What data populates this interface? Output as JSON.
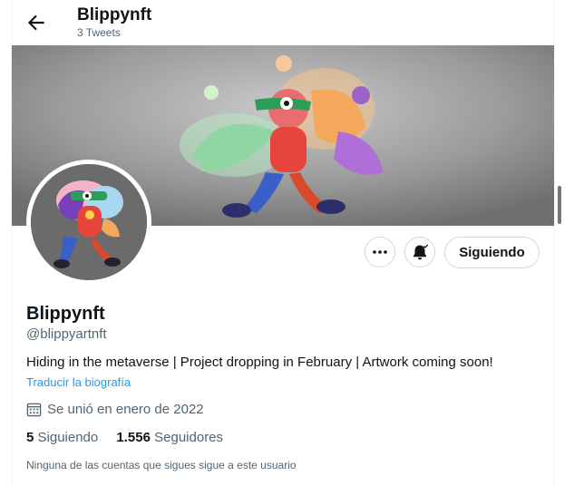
{
  "header": {
    "name": "Blippynft",
    "tweet_count": "3 Tweets"
  },
  "profile": {
    "display_name": "Blippynft",
    "handle": "@blippyartnft",
    "bio": "Hiding in the metaverse | Project dropping in February | Artwork coming soon!",
    "translate_link": "Traducir la biografía",
    "joined": "Se unió en enero de 2022",
    "following_count": "5",
    "following_label": "Siguiendo",
    "followers_count": "1.556",
    "followers_label": "Seguidores",
    "no_common_followers": "Ninguna de las cuentas que sigues sigue a este usuario"
  },
  "actions": {
    "follow_button": "Siguiendo"
  },
  "icons": {
    "back": "arrow-left-icon",
    "more": "more-dots-icon",
    "notifications": "bell-check-icon",
    "calendar": "calendar-icon"
  },
  "colors": {
    "accent": "#1d9bf0",
    "secondary_text": "#536471",
    "primary_text": "#0f1419"
  }
}
